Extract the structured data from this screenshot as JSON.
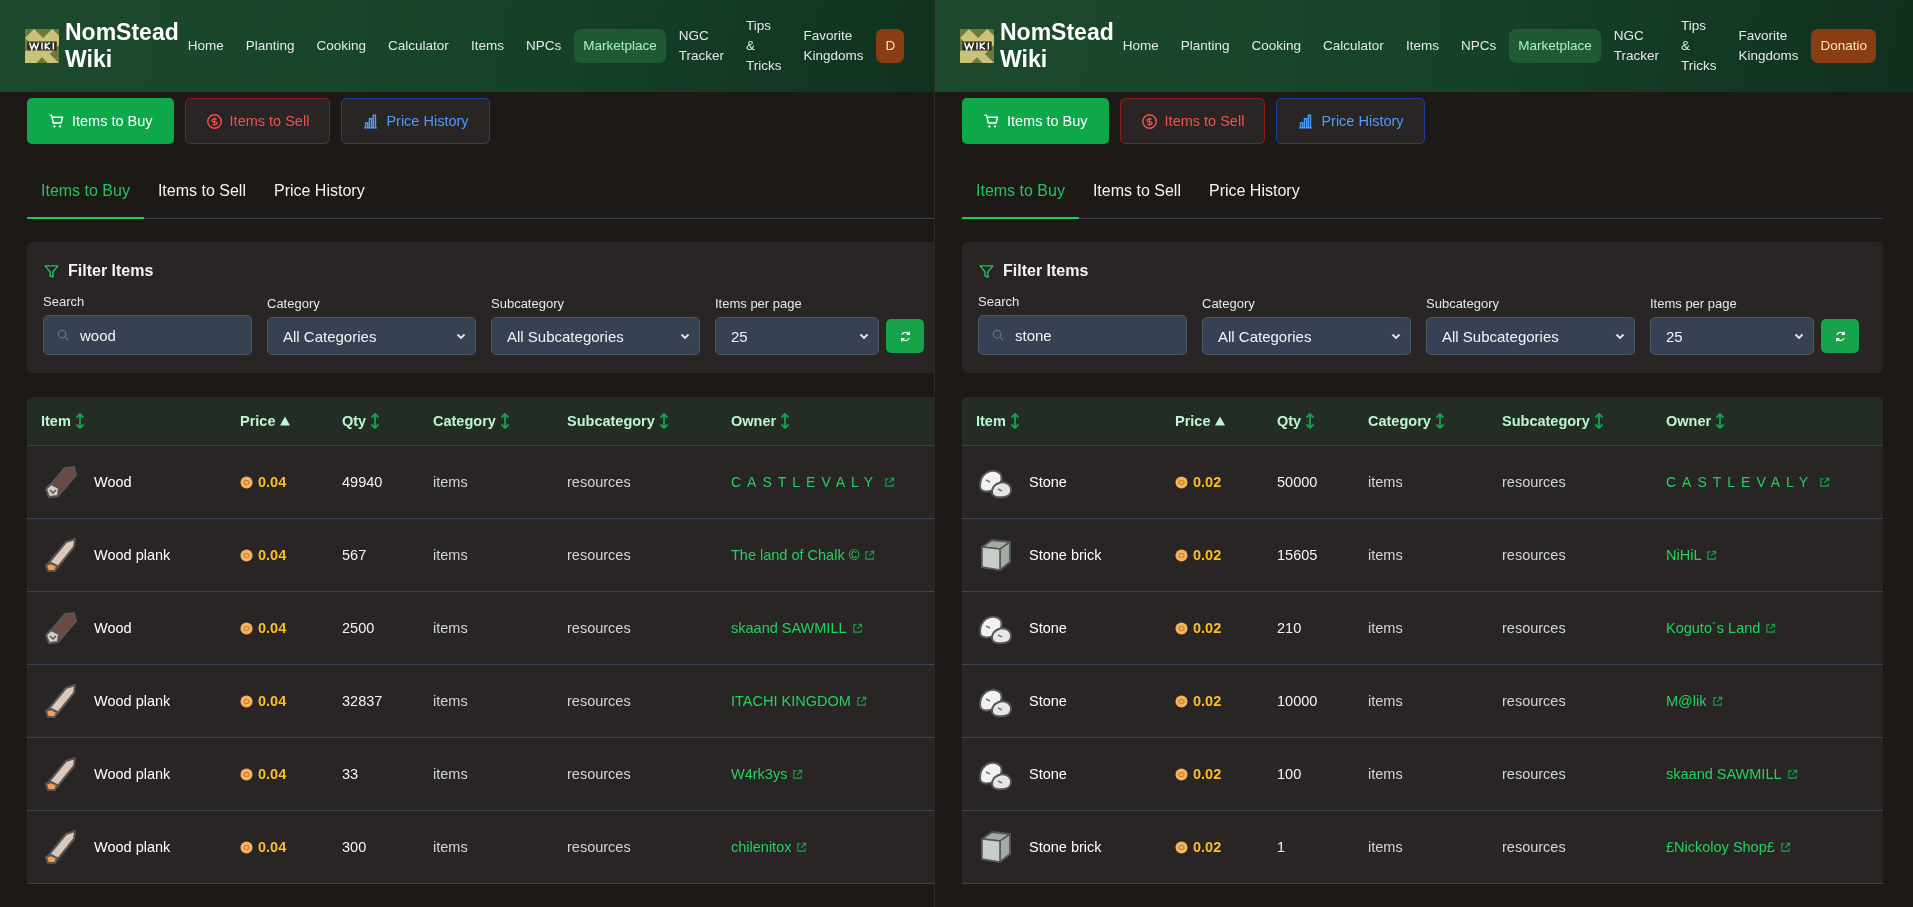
{
  "panes": [
    {
      "header": {
        "site_title": "NomStead Wiki",
        "nav": [
          {
            "label": "Home",
            "kind": "link",
            "selected": false
          },
          {
            "label": "Planting",
            "kind": "link",
            "selected": false
          },
          {
            "label": "Cooking",
            "kind": "link",
            "selected": false
          },
          {
            "label": "Calculator",
            "kind": "link",
            "selected": false
          },
          {
            "label": "Items",
            "kind": "link",
            "selected": false
          },
          {
            "label": "NPCs",
            "kind": "link",
            "selected": false
          },
          {
            "label": "Marketplace",
            "kind": "link",
            "selected": true
          },
          {
            "label": "NGC Tracker",
            "kind": "link",
            "selected": false
          },
          {
            "label": "Tips & Tricks",
            "kind": "link",
            "selected": false
          },
          {
            "label": "Favorite Kingdoms",
            "kind": "link",
            "selected": false
          },
          {
            "label": "D",
            "kind": "donate",
            "selected": false
          }
        ]
      },
      "action_buttons": [
        {
          "label": "Items to Buy",
          "kind": "buy"
        },
        {
          "label": "Items to Sell",
          "kind": "sell"
        },
        {
          "label": "Price History",
          "kind": "history"
        }
      ],
      "tabs": [
        {
          "label": "Items to Buy",
          "selected": true
        },
        {
          "label": "Items to Sell",
          "selected": false
        },
        {
          "label": "Price History",
          "selected": false
        }
      ],
      "filter": {
        "title": "Filter Items",
        "search": {
          "label": "Search",
          "value": "wood"
        },
        "category": {
          "label": "Category",
          "value": "All Categories"
        },
        "subcategory": {
          "label": "Subcategory",
          "value": "All Subcategories"
        },
        "per_page": {
          "label": "Items per page",
          "value": "25"
        }
      },
      "table": {
        "columns": [
          {
            "label": "Item",
            "kind": "sortable"
          },
          {
            "label": "Price",
            "kind": "ascending"
          },
          {
            "label": "Qty",
            "kind": "sortable"
          },
          {
            "label": "Category",
            "kind": "sortable"
          },
          {
            "label": "Subcategory",
            "kind": "sortable"
          },
          {
            "label": "Owner",
            "kind": "sortable"
          }
        ],
        "rows": [
          {
            "kind": "log",
            "item": "Wood",
            "price": "0.04",
            "qty": "49940",
            "category": "items",
            "subcategory": "resources",
            "owner": {
              "label": "CASTLEVALY",
              "kind": "wordmark"
            }
          },
          {
            "kind": "plank",
            "item": "Wood plank",
            "price": "0.04",
            "qty": "567",
            "category": "items",
            "subcategory": "resources",
            "owner": "The land of Chalk ©"
          },
          {
            "kind": "log",
            "item": "Wood",
            "price": "0.04",
            "qty": "2500",
            "category": "items",
            "subcategory": "resources",
            "owner": "skaand SAWMILL"
          },
          {
            "kind": "plank",
            "item": "Wood plank",
            "price": "0.04",
            "qty": "32837",
            "category": "items",
            "subcategory": "resources",
            "owner": "ITACHI KINGDOM"
          },
          {
            "kind": "plank",
            "item": "Wood plank",
            "price": "0.04",
            "qty": "33",
            "category": "items",
            "subcategory": "resources",
            "owner": "W4rk3ys"
          },
          {
            "kind": "plank",
            "item": "Wood plank",
            "price": "0.04",
            "qty": "300",
            "category": "items",
            "subcategory": "resources",
            "owner": "chilenitox"
          }
        ]
      }
    },
    {
      "header": {
        "site_title": "NomStead Wiki",
        "nav": [
          {
            "label": "Home",
            "kind": "link",
            "selected": false
          },
          {
            "label": "Planting",
            "kind": "link",
            "selected": false
          },
          {
            "label": "Cooking",
            "kind": "link",
            "selected": false
          },
          {
            "label": "Calculator",
            "kind": "link",
            "selected": false
          },
          {
            "label": "Items",
            "kind": "link",
            "selected": false
          },
          {
            "label": "NPCs",
            "kind": "link",
            "selected": false
          },
          {
            "label": "Marketplace",
            "kind": "link",
            "selected": true
          },
          {
            "label": "NGC Tracker",
            "kind": "link",
            "selected": false
          },
          {
            "label": "Tips & Tricks",
            "kind": "link",
            "selected": false
          },
          {
            "label": "Favorite Kingdoms",
            "kind": "link",
            "selected": false
          },
          {
            "label": "Donatio",
            "kind": "donate",
            "selected": false
          }
        ]
      },
      "action_buttons": [
        {
          "label": "Items to Buy",
          "kind": "buy"
        },
        {
          "label": "Items to Sell",
          "kind": "sell"
        },
        {
          "label": "Price History",
          "kind": "history"
        }
      ],
      "tabs": [
        {
          "label": "Items to Buy",
          "selected": true
        },
        {
          "label": "Items to Sell",
          "selected": false
        },
        {
          "label": "Price History",
          "selected": false
        }
      ],
      "filter": {
        "title": "Filter Items",
        "search": {
          "label": "Search",
          "value": "stone"
        },
        "category": {
          "label": "Category",
          "value": "All Categories"
        },
        "subcategory": {
          "label": "Subcategory",
          "value": "All Subcategories"
        },
        "per_page": {
          "label": "Items per page",
          "value": "25"
        }
      },
      "table": {
        "columns": [
          {
            "label": "Item",
            "kind": "sortable"
          },
          {
            "label": "Price",
            "kind": "ascending"
          },
          {
            "label": "Qty",
            "kind": "sortable"
          },
          {
            "label": "Category",
            "kind": "sortable"
          },
          {
            "label": "Subcategory",
            "kind": "sortable"
          },
          {
            "label": "Owner",
            "kind": "sortable"
          }
        ],
        "rows": [
          {
            "kind": "stone",
            "item": "Stone",
            "price": "0.02",
            "qty": "50000",
            "category": "items",
            "subcategory": "resources",
            "owner": {
              "label": "CASTLEVALY",
              "kind": "wordmark"
            }
          },
          {
            "kind": "brick",
            "item": "Stone brick",
            "price": "0.02",
            "qty": "15605",
            "category": "items",
            "subcategory": "resources",
            "owner": "NiHiL"
          },
          {
            "kind": "stone",
            "item": "Stone",
            "price": "0.02",
            "qty": "210",
            "category": "items",
            "subcategory": "resources",
            "owner": "Koguto´s Land"
          },
          {
            "kind": "stone",
            "item": "Stone",
            "price": "0.02",
            "qty": "10000",
            "category": "items",
            "subcategory": "resources",
            "owner": "M@lik"
          },
          {
            "kind": "stone",
            "item": "Stone",
            "price": "0.02",
            "qty": "100",
            "category": "items",
            "subcategory": "resources",
            "owner": "skaand SAWMILL"
          },
          {
            "kind": "brick",
            "item": "Stone brick",
            "price": "0.02",
            "qty": "1",
            "category": "items",
            "subcategory": "resources",
            "owner": "£Nickoloy Shop£"
          }
        ]
      }
    }
  ]
}
